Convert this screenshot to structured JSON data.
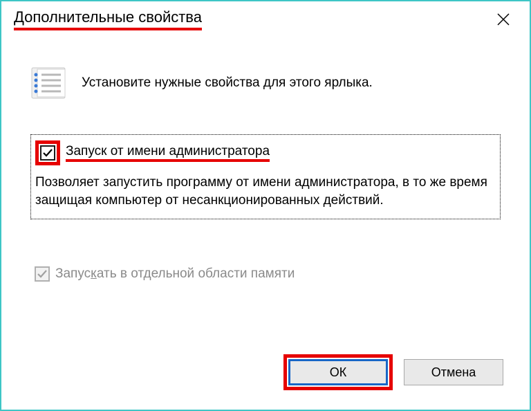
{
  "title": "Дополнительные свойства",
  "instruction": "Установите нужные свойства для этого ярлыка.",
  "option1": {
    "label": "Запуск от имени администратора",
    "checked": true,
    "description": "Позволяет запустить программу от имени администратора, в то же время защищая компьютер от несанкционированных действий."
  },
  "option2": {
    "label": "Запускать в отдельной области памяти",
    "checked": true,
    "disabled": true
  },
  "buttons": {
    "ok": "ОК",
    "cancel": "Отмена"
  }
}
